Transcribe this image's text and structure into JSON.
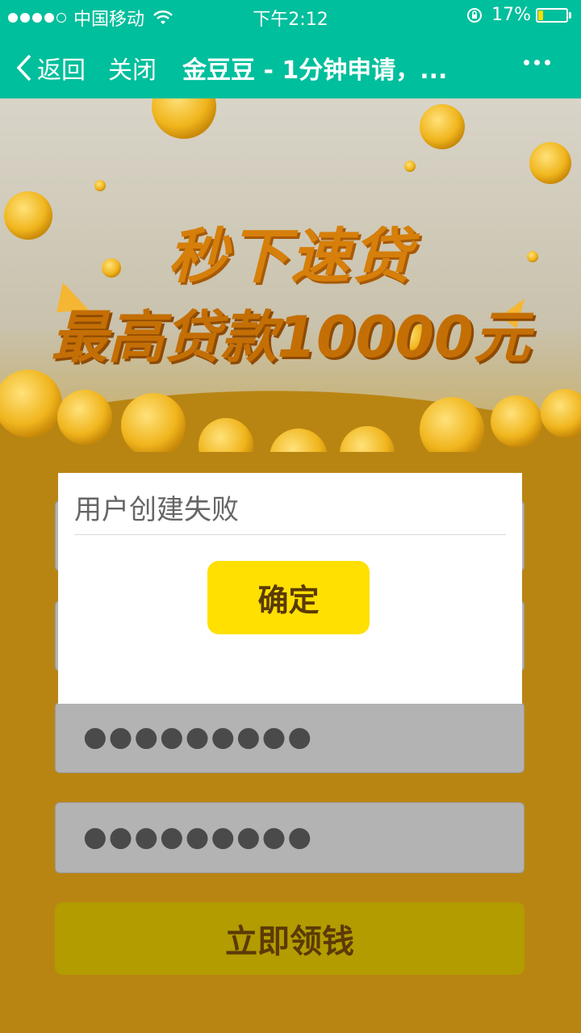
{
  "statusbar": {
    "carrier": "中国移动",
    "time": "下午2:12",
    "battery": "17%",
    "battery_level": 0.17
  },
  "nav": {
    "back_label": "返回",
    "close_label": "关闭",
    "title": "金豆豆 - 1分钟申请，..."
  },
  "banner": {
    "headline1": "秒下速贷",
    "headline2": "最高贷款10000元"
  },
  "form": {
    "password_mask": "●●●●●●●●●",
    "confirm_mask": "●●●●●●●●●",
    "submit_label": "立即领钱"
  },
  "dialog": {
    "message": "用户创建失败",
    "ok_label": "确定"
  },
  "colors": {
    "header": "#00bf9c",
    "button_yellow": "#ffe000",
    "form_bg": "#b98512"
  }
}
